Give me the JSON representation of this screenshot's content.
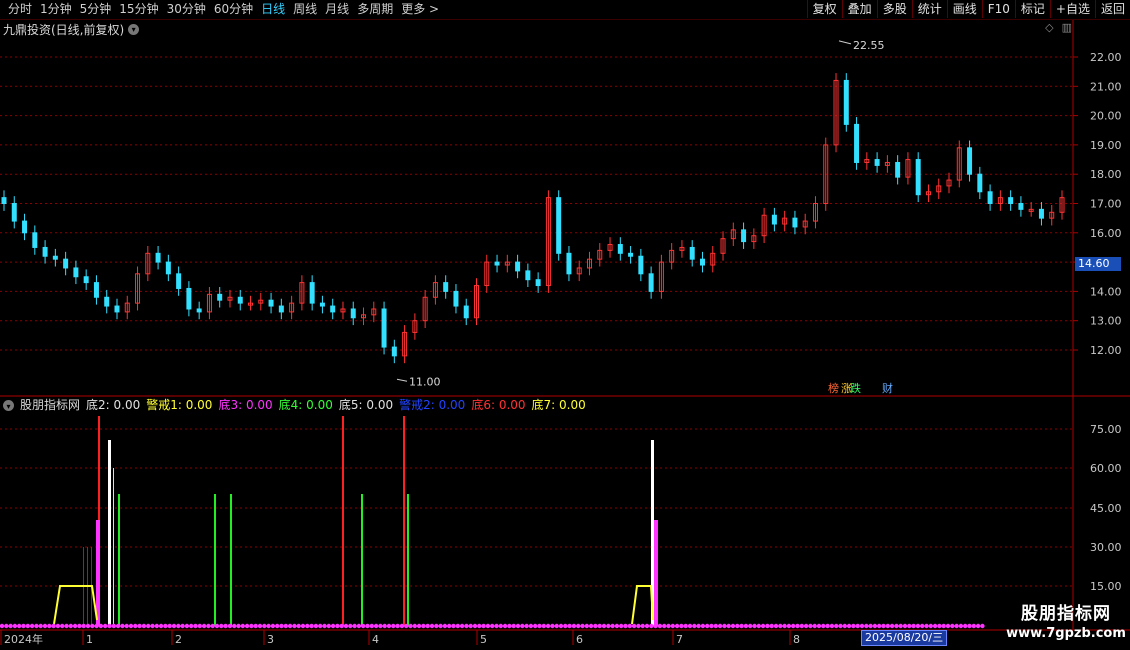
{
  "toolbar": {
    "periods": [
      "分时",
      "1分钟",
      "5分钟",
      "15分钟",
      "30分钟",
      "60分钟",
      "日线",
      "周线",
      "月线",
      "多周期",
      "更多 >"
    ],
    "active_period": "日线",
    "buttons": [
      "复权",
      "叠加",
      "多股",
      "统计",
      "画线",
      "F10",
      "标记",
      "+自选",
      "返回"
    ]
  },
  "main_chart": {
    "title": "九鼎投资(日线,前复权)",
    "price_axis": [
      "22.00",
      "21.00",
      "20.00",
      "19.00",
      "18.00",
      "17.00",
      "16.00",
      "15.00",
      "14.00",
      "13.00",
      "12.00"
    ],
    "current_price": "14.60",
    "high_label": "22.55",
    "low_label": "11.00",
    "badges": [
      "榜",
      "涨",
      "跌",
      "财"
    ]
  },
  "indicator": {
    "name": "股朋指标网",
    "items": [
      {
        "label": "底2:",
        "value": "0.00",
        "color": "#e0e0e0"
      },
      {
        "label": "警戒1:",
        "value": "0.00",
        "color": "#ffff33"
      },
      {
        "label": "底3:",
        "value": "0.00",
        "color": "#ff33ff"
      },
      {
        "label": "底4:",
        "value": "0.00",
        "color": "#33ff33"
      },
      {
        "label": "底5:",
        "value": "0.00",
        "color": "#e0e0e0"
      },
      {
        "label": "警戒2:",
        "value": "0.00",
        "color": "#2244ff"
      },
      {
        "label": "底6:",
        "value": "0.00",
        "color": "#ff3333"
      },
      {
        "label": "底7:",
        "value": "0.00",
        "color": "#ffff33"
      }
    ],
    "axis": [
      "75.00",
      "60.00",
      "45.00",
      "30.00",
      "15.00"
    ]
  },
  "time_axis": {
    "labels": [
      "2024年",
      "1",
      "2",
      "3",
      "4",
      "5",
      "6",
      "7",
      "8"
    ],
    "cursor_date": "2025/08/20/三"
  },
  "colors": {
    "up": "#ff3333",
    "down": "#33e0ff",
    "grid": "#8a0000"
  },
  "watermark": {
    "line1": "股朋指标网",
    "line2": "www.7gpzb.com"
  }
}
